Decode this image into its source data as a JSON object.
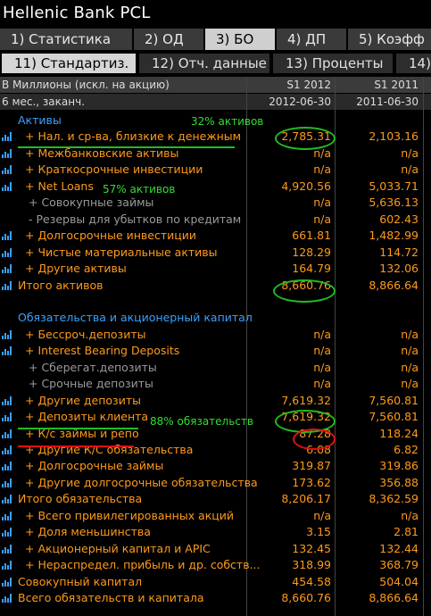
{
  "window": {
    "title": "Hellenic Bank PCL"
  },
  "tabs": [
    {
      "label": "1) Статистика",
      "active": false
    },
    {
      "label": "2) ОД",
      "active": false
    },
    {
      "label": "3) БО",
      "active": true
    },
    {
      "label": "4) ДП",
      "active": false
    },
    {
      "label": "5) Коэфф",
      "active": false
    }
  ],
  "subtabs": [
    {
      "label": "11) Стандартиз.",
      "active": true
    },
    {
      "label": "12) Отч. данные",
      "active": false
    },
    {
      "label": "13) Проценты",
      "active": false
    },
    {
      "label": "14)",
      "active": false
    }
  ],
  "header": {
    "units": "В Миллионы (искл. на акцию)",
    "col1": "S1 2012",
    "col2": "S1 2011",
    "period_label": "6 мес., заканч.",
    "date1": "2012-06-30",
    "date2": "2011-06-30"
  },
  "rows": [
    {
      "label": "Активы",
      "v1": "",
      "v2": "",
      "kind": "section",
      "icon": false
    },
    {
      "label": "+ Нал. и ср-ва, близкие к денежным",
      "v1": "2,785.31",
      "v2": "2,103.16",
      "kind": "item",
      "icon": true
    },
    {
      "label": "+ Межбанковские активы",
      "v1": "n/a",
      "v2": "n/a",
      "kind": "item",
      "icon": true
    },
    {
      "label": "+ Краткосрочные инвестиции",
      "v1": "n/a",
      "v2": "n/a",
      "kind": "item",
      "icon": true
    },
    {
      "label": "+ Net Loans",
      "v1": "4,920.56",
      "v2": "5,033.71",
      "kind": "item",
      "icon": true
    },
    {
      "label": "+ Совокупные займы",
      "v1": "n/a",
      "v2": "5,636.13",
      "kind": "dim",
      "icon": false
    },
    {
      "label": "- Резервы для убытков по кредитам",
      "v1": "n/a",
      "v2": "602.43",
      "kind": "dim",
      "icon": false
    },
    {
      "label": "+ Долгосрочные инвестиции",
      "v1": "661.81",
      "v2": "1,482.99",
      "kind": "item",
      "icon": true
    },
    {
      "label": "+ Чистые материальные активы",
      "v1": "128.29",
      "v2": "114.72",
      "kind": "item",
      "icon": true
    },
    {
      "label": "+ Другие активы",
      "v1": "164.79",
      "v2": "132.06",
      "kind": "item",
      "icon": true
    },
    {
      "label": "Итого активов",
      "v1": "8,660.76",
      "v2": "8,866.64",
      "kind": "total",
      "icon": true
    },
    {
      "label": "",
      "v1": "",
      "v2": "",
      "kind": "blank",
      "icon": false
    },
    {
      "label": "Обязательства и акционерный капитал",
      "v1": "",
      "v2": "",
      "kind": "section",
      "icon": false
    },
    {
      "label": "+ Бессроч.депозиты",
      "v1": "n/a",
      "v2": "n/a",
      "kind": "item",
      "icon": true
    },
    {
      "label": "+ Interest Bearing Deposits",
      "v1": "n/a",
      "v2": "n/a",
      "kind": "item",
      "icon": true
    },
    {
      "label": "+ Сберегат.депозиты",
      "v1": "n/a",
      "v2": "n/a",
      "kind": "dim",
      "icon": false
    },
    {
      "label": "+ Срочные депозиты",
      "v1": "n/a",
      "v2": "n/a",
      "kind": "dim",
      "icon": false
    },
    {
      "label": "+ Другие депозиты",
      "v1": "7,619.32",
      "v2": "7,560.81",
      "kind": "item",
      "icon": true
    },
    {
      "label": "+ Депозиты клиента",
      "v1": "7,619.32",
      "v2": "7,560.81",
      "kind": "item",
      "icon": true
    },
    {
      "label": "+ К/с займы и репо",
      "v1": "87.28",
      "v2": "118.24",
      "kind": "item",
      "icon": true
    },
    {
      "label": "+ Другие К/С обязательства",
      "v1": "6.08",
      "v2": "6.82",
      "kind": "item",
      "icon": true
    },
    {
      "label": "+ Долгосрочные займы",
      "v1": "319.87",
      "v2": "319.86",
      "kind": "item",
      "icon": true
    },
    {
      "label": "+ Другие долгосрочные обязательства",
      "v1": "173.62",
      "v2": "356.88",
      "kind": "item",
      "icon": true
    },
    {
      "label": "Итого обязательства",
      "v1": "8,206.17",
      "v2": "8,362.59",
      "kind": "total",
      "icon": true
    },
    {
      "label": "+ Всего привилегированных акций",
      "v1": "n/a",
      "v2": "n/a",
      "kind": "item",
      "icon": true
    },
    {
      "label": "+ Доля меньшинства",
      "v1": "3.15",
      "v2": "2.81",
      "kind": "item",
      "icon": true
    },
    {
      "label": "+ Акционерный капитал и APIC",
      "v1": "132.45",
      "v2": "132.44",
      "kind": "item",
      "icon": true
    },
    {
      "label": "+ Нераспредел. прибыль и др. собств...",
      "v1": "318.99",
      "v2": "368.79",
      "kind": "item",
      "icon": true
    },
    {
      "label": "Совокупный капитал",
      "v1": "454.58",
      "v2": "504.04",
      "kind": "total",
      "icon": true
    },
    {
      "label": "Всего обязательств и капитала",
      "v1": "8,660.76",
      "v2": "8,866.64",
      "kind": "total",
      "icon": true
    }
  ],
  "annotations": {
    "cash_pct": "32% активов",
    "loans_pct": "57% активов",
    "deposits_pct": "88% обязательств"
  },
  "colors": {
    "accent_orange": "#ff9a1a",
    "section_blue": "#3aa0ff",
    "annotation_green": "#33dd33",
    "highlight_red": "#e01010"
  }
}
